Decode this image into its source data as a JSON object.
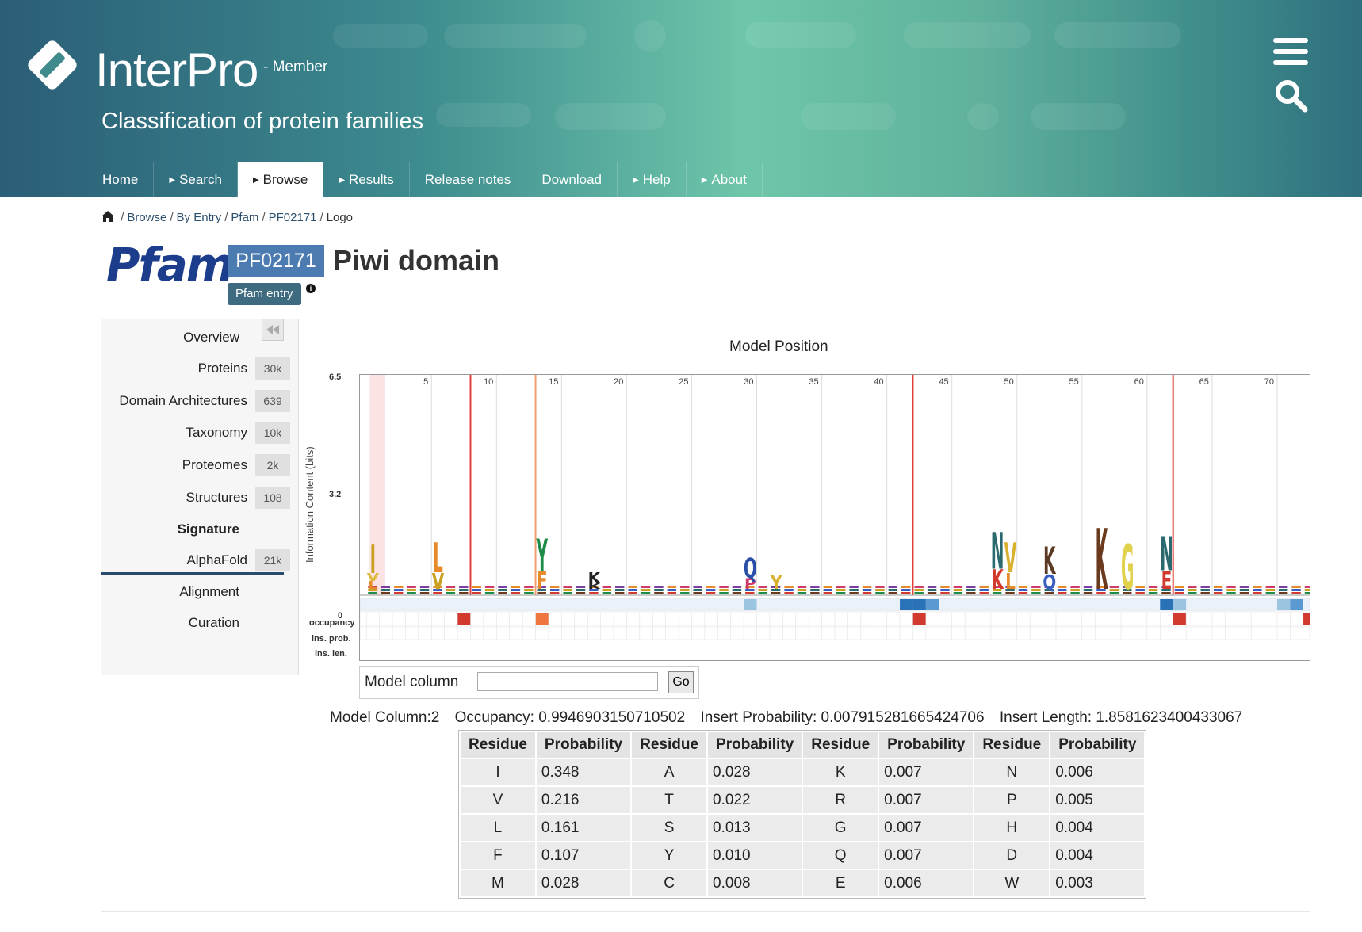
{
  "header": {
    "brand": "InterPro",
    "brand_sub": "- Member",
    "tagline": "Classification of protein families"
  },
  "nav": [
    {
      "label": "Home",
      "has_arrow": false,
      "active": false
    },
    {
      "label": "Search",
      "has_arrow": true,
      "active": false
    },
    {
      "label": "Browse",
      "has_arrow": true,
      "active": true
    },
    {
      "label": "Results",
      "has_arrow": true,
      "active": false
    },
    {
      "label": "Release notes",
      "has_arrow": false,
      "active": false
    },
    {
      "label": "Download",
      "has_arrow": false,
      "active": false
    },
    {
      "label": "Help",
      "has_arrow": true,
      "active": false
    },
    {
      "label": "About",
      "has_arrow": true,
      "active": false
    }
  ],
  "breadcrumb": [
    "Browse",
    "By Entry",
    "Pfam",
    "PF02171",
    "Logo"
  ],
  "entry": {
    "logo_text": "Pfam",
    "accession": "PF02171",
    "title": "Piwi domain",
    "type_label": "Pfam entry"
  },
  "sidebar": [
    {
      "label": "Overview",
      "count": null
    },
    {
      "label": "Proteins",
      "count": "30k"
    },
    {
      "label": "Domain Architectures",
      "count": "639"
    },
    {
      "label": "Taxonomy",
      "count": "10k"
    },
    {
      "label": "Proteomes",
      "count": "2k"
    },
    {
      "label": "Structures",
      "count": "108"
    },
    {
      "label": "Signature",
      "count": null,
      "active": true
    },
    {
      "label": "AlphaFold",
      "count": "21k"
    },
    {
      "label": "Alignment",
      "count": null
    },
    {
      "label": "Curation",
      "count": null
    }
  ],
  "logo": {
    "title": "Model Position",
    "ylabel": "Information Content (bits)",
    "yticks": [
      "6.5",
      "3.2",
      "0"
    ],
    "row_labels": [
      "occupancy",
      "ins. prob.",
      "ins. len."
    ],
    "position_ticks": [
      "5",
      "10",
      "15",
      "20",
      "25",
      "30",
      "35",
      "40",
      "45",
      "50",
      "55",
      "60",
      "65",
      "70"
    ],
    "tall_letters": [
      {
        "pos": 1,
        "letters": [
          "I",
          "V",
          "L"
        ],
        "colors": [
          "#c9a020",
          "#e0b83a",
          "#e78b2a"
        ],
        "h": 0.21
      },
      {
        "pos": 6,
        "letters": [
          "L",
          "V"
        ],
        "colors": [
          "#e78b2a",
          "#c9a020"
        ],
        "h": 0.22
      },
      {
        "pos": 14,
        "letters": [
          "Y",
          "F"
        ],
        "colors": [
          "#1f8d4a",
          "#e78b2a"
        ],
        "h": 0.24
      },
      {
        "pos": 18,
        "letters": [
          "K",
          "K"
        ],
        "colors": [
          "#222",
          "#222"
        ],
        "h": 0.08
      },
      {
        "pos": 30,
        "letters": [
          "Q",
          "P"
        ],
        "colors": [
          "#2a4fa8",
          "#d03a6b"
        ],
        "h": 0.15
      },
      {
        "pos": 32,
        "letters": [
          "Y"
        ],
        "colors": [
          "#d9b12f"
        ],
        "h": 0.1
      },
      {
        "pos": 49,
        "letters": [
          "N",
          "K"
        ],
        "colors": [
          "#2a6a6e",
          "#d2392f"
        ],
        "h": 0.27
      },
      {
        "pos": 50,
        "letters": [
          "V",
          "L"
        ],
        "colors": [
          "#d9b12f",
          "#e78b2a"
        ],
        "h": 0.22
      },
      {
        "pos": 53,
        "letters": [
          "K",
          "Q"
        ],
        "colors": [
          "#5a3a22",
          "#3a5ec0"
        ],
        "h": 0.2
      },
      {
        "pos": 57,
        "letters": [
          "K"
        ],
        "colors": [
          "#6b3a1e"
        ],
        "h": 0.45
      },
      {
        "pos": 59,
        "letters": [
          "G"
        ],
        "colors": [
          "#e0d24a"
        ],
        "h": 0.33
      },
      {
        "pos": 62,
        "letters": [
          "N",
          "E"
        ],
        "colors": [
          "#2a6a6e",
          "#d2392f"
        ],
        "h": 0.25
      }
    ]
  },
  "model_column": {
    "label": "Model column",
    "input_value": "",
    "button": "Go"
  },
  "column_info": {
    "model_column": "Model Column:2",
    "occupancy": "Occupancy: 0.9946903150710502",
    "insert_probability": "Insert Probability: 0.007915281665424706",
    "insert_length": "Insert Length: 1.8581623400433067"
  },
  "prob_table": {
    "headers": [
      "Residue",
      "Probability",
      "Residue",
      "Probability",
      "Residue",
      "Probability",
      "Residue",
      "Probability"
    ],
    "rows": [
      [
        "I",
        "0.348",
        "A",
        "0.028",
        "K",
        "0.007",
        "N",
        "0.006"
      ],
      [
        "V",
        "0.216",
        "T",
        "0.022",
        "R",
        "0.007",
        "P",
        "0.005"
      ],
      [
        "L",
        "0.161",
        "S",
        "0.013",
        "G",
        "0.007",
        "H",
        "0.004"
      ],
      [
        "F",
        "0.107",
        "Y",
        "0.010",
        "Q",
        "0.007",
        "D",
        "0.004"
      ],
      [
        "M",
        "0.028",
        "C",
        "0.008",
        "E",
        "0.006",
        "W",
        "0.003"
      ]
    ]
  }
}
